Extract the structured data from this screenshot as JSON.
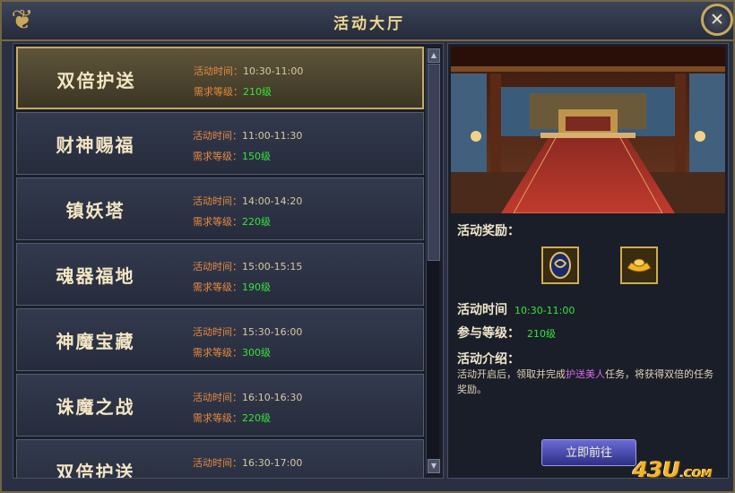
{
  "window": {
    "title": "活动大厅",
    "close_label": "✕"
  },
  "labels": {
    "time_prefix": "活动时间：",
    "level_prefix": "需求等级："
  },
  "events": [
    {
      "name": "双倍护送",
      "time": "10:30-11:00",
      "level": "210级",
      "selected": true
    },
    {
      "name": "财神赐福",
      "time": "11:00-11:30",
      "level": "150级",
      "selected": false
    },
    {
      "name": "镇妖塔",
      "time": "14:00-14:20",
      "level": "220级",
      "selected": false
    },
    {
      "name": "魂器福地",
      "time": "15:00-15:15",
      "level": "190级",
      "selected": false
    },
    {
      "name": "神魔宝藏",
      "time": "15:30-16:00",
      "level": "300级",
      "selected": false
    },
    {
      "name": "诛魔之战",
      "time": "16:10-16:30",
      "level": "220级",
      "selected": false
    },
    {
      "name": "双倍护送",
      "time": "16:30-17:00",
      "level": "",
      "selected": false
    }
  ],
  "details": {
    "reward_label": "活动奖励：",
    "rewards": [
      "token-icon",
      "gold-ingot-icon"
    ],
    "time_label": "活动时间",
    "time_value": "10:30-11:00",
    "level_label": "参与等级：",
    "level_value": "210级",
    "desc_label": "活动介绍：",
    "desc_before": "活动开启后，领取并完成",
    "desc_highlight": "护送美人",
    "desc_after": "任务，将获得双倍的任务奖励。",
    "go_button": "立即前往"
  },
  "logo": {
    "main": "43U",
    "suffix": ".COM"
  },
  "colors": {
    "accent_gold": "#c6aa66",
    "level_green": "#38e33a",
    "prefix_orange": "#e88a3f",
    "highlight_purple": "#d46ae8"
  }
}
